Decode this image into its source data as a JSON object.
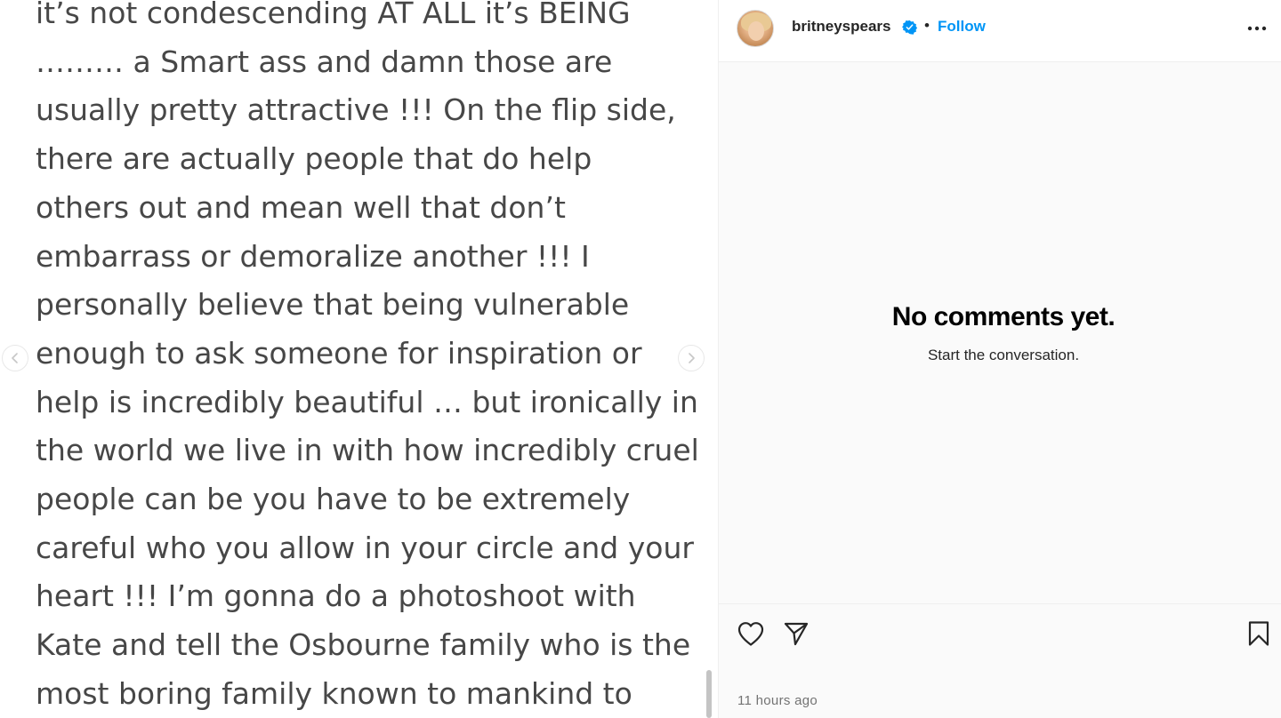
{
  "post": {
    "lines": [
      "it’s not condescending AT ALL it’s BEING",
      "……… a Smart ass and damn those are",
      "usually pretty attractive !!! On the flip side,",
      "there are actually people that do help",
      "others out and mean well that don’t",
      "embarrass or demoralize another !!! I",
      "personally believe that being vulnerable",
      "enough to ask someone for inspiration or",
      "help is incredibly beautiful … but ironically in",
      "the world we live in with how incredibly cruel",
      "people can be you have to be extremely",
      "careful who you allow in your circle and your",
      "heart !!! I’m gonna do a photoshoot with",
      "Kate and tell the Osbourne family who is the",
      "most boring family known to mankind to"
    ]
  },
  "nav": {
    "prev_icon": "chevron-left-icon",
    "next_icon": "chevron-right-icon"
  },
  "header": {
    "username": "britneyspears",
    "separator": "•",
    "follow_label": "Follow",
    "verified_icon": "verified-badge-icon",
    "more_icon": "more-options-icon"
  },
  "comments": {
    "empty_title": "No comments yet.",
    "empty_subtitle": "Start the conversation."
  },
  "actions": {
    "like_icon": "heart-icon",
    "share_icon": "paper-plane-icon",
    "save_icon": "bookmark-icon",
    "timestamp": "11 hours ago"
  },
  "colors": {
    "accent": "#0095f6",
    "text_primary": "#262626",
    "text_secondary": "#737373",
    "post_text": "#474747"
  }
}
